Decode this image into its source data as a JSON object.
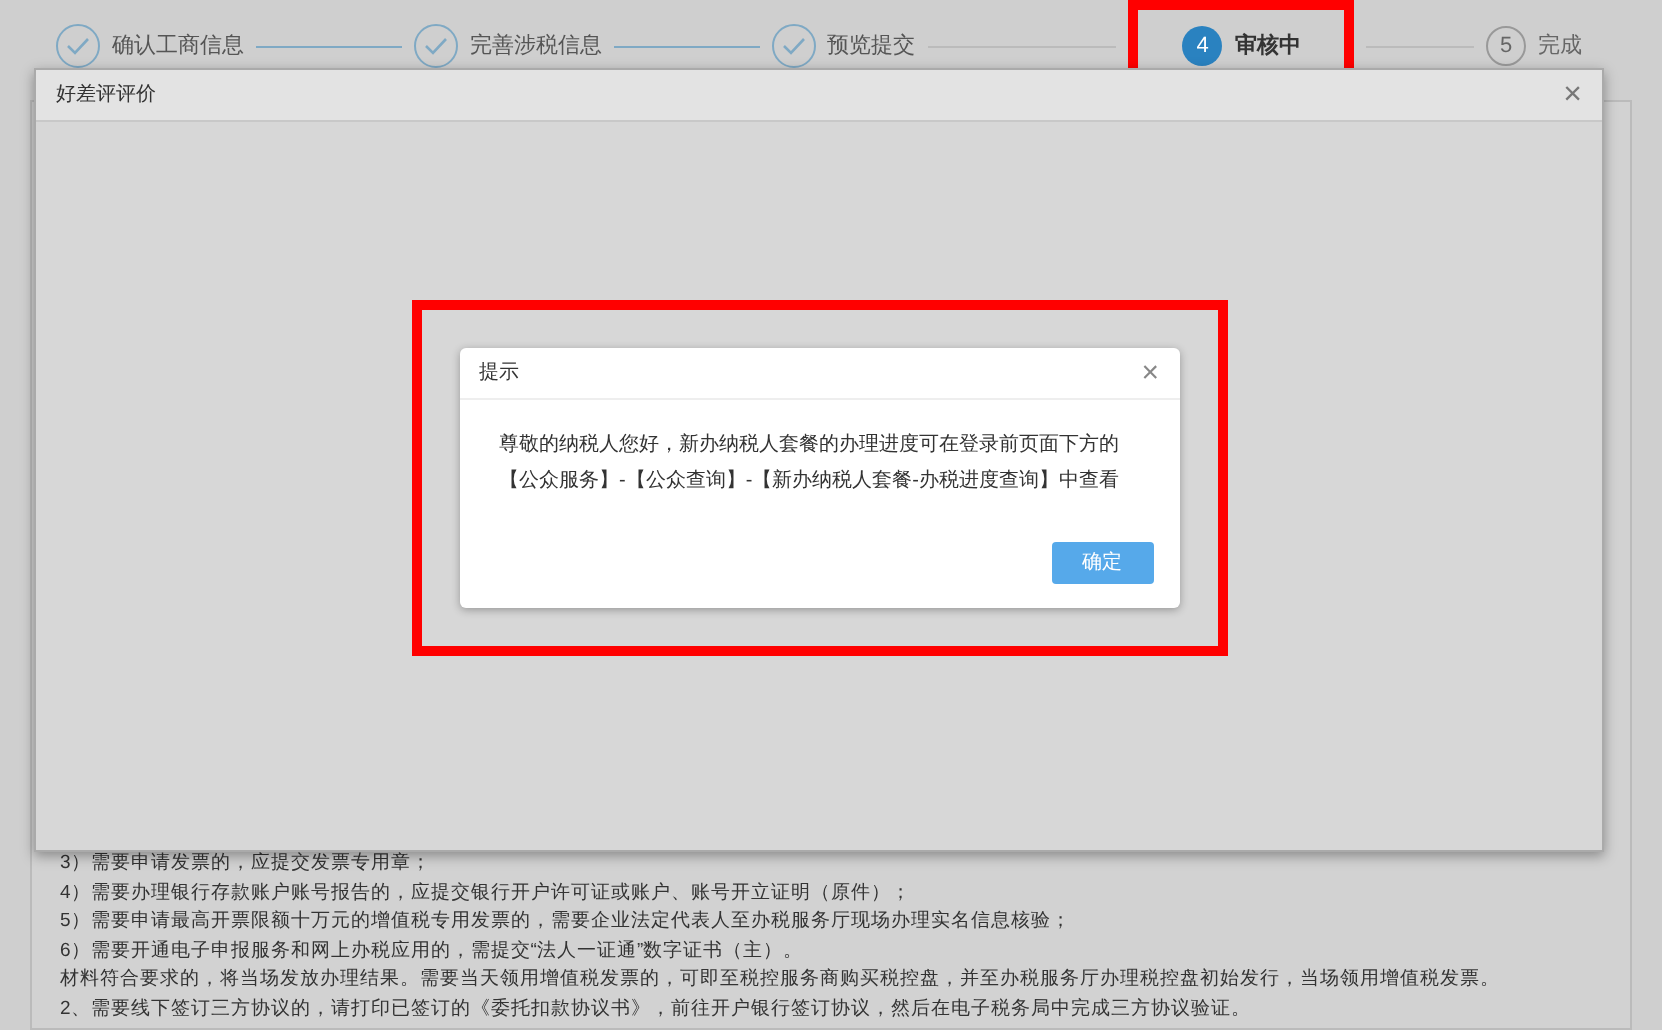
{
  "steps": [
    {
      "label": "确认工商信息",
      "completed": true,
      "current": false,
      "highlighted": false
    },
    {
      "label": "完善涉税信息",
      "completed": true,
      "current": false,
      "highlighted": false
    },
    {
      "label": "预览提交",
      "completed": true,
      "current": false,
      "highlighted": false
    },
    {
      "number": "4",
      "label": "审核中",
      "completed": false,
      "current": true,
      "highlighted": true
    },
    {
      "number": "5",
      "label": "完成",
      "completed": false,
      "current": false,
      "highlighted": false
    }
  ],
  "notes": [
    "3）需要申请发票的，应提交发票专用章；",
    "4）需要办理银行存款账户账号报告的，应提交银行开户许可证或账户、账号开立证明（原件）；",
    "5）需要申请最高开票限额十万元的增值税专用发票的，需要企业法定代表人至办税服务厅现场办理实名信息核验；",
    "6）需要开通电子申报服务和网上办税应用的，需提交“法人一证通”数字证书（主）。",
    "材料符合要求的，将当场发放办理结果。需要当天领用增值税发票的，可即至税控服务商购买税控盘，并至办税服务厅办理税控盘初始发行，当场领用增值税发票。",
    "2、需要线下签订三方协议的，请打印已签订的《委托扣款协议书》，前往开户银行签订协议，然后在电子税务局中完成三方协议验证。"
  ],
  "modal": {
    "title": "好差评评价",
    "close": "×"
  },
  "dialog": {
    "title": "提示",
    "close": "×",
    "message": "尊敬的纳税人您好，新办纳税人套餐的办理进度可在登录前页面下方的【公众服务】-【公众查询】-【新办纳税人套餐-办税进度查询】中查看",
    "button": "确定",
    "highlighted": true
  }
}
